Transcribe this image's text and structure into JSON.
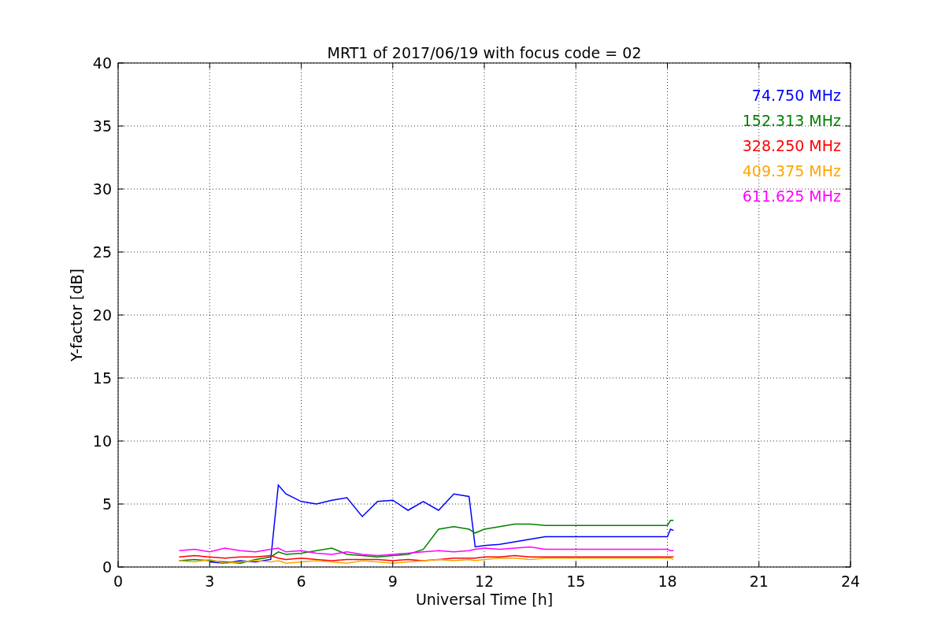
{
  "figure": {
    "chart_data": {
      "type": "line",
      "title": "MRT1 of 2017/06/19 with focus code = 02",
      "xlabel": "Universal Time [h]",
      "ylabel": "Y-factor [dB]",
      "x": [
        2,
        2.5,
        3,
        3.5,
        4,
        4.5,
        5,
        5.25,
        5.5,
        6,
        6.5,
        7,
        7.5,
        8,
        8.5,
        9,
        9.5,
        10,
        10.5,
        11,
        11.5,
        11.7,
        12,
        12.5,
        13,
        13.5,
        14,
        18,
        18.1,
        18.2
      ],
      "series": [
        {
          "name": "74.750 MHz",
          "color": "#0000ff",
          "values": [
            null,
            null,
            0.4,
            0.3,
            0.5,
            0.4,
            0.6,
            6.5,
            5.8,
            5.2,
            5.0,
            5.3,
            5.5,
            4.0,
            5.2,
            5.3,
            4.5,
            5.2,
            4.5,
            5.8,
            5.6,
            1.6,
            1.7,
            1.8,
            2.0,
            2.2,
            2.4,
            2.4,
            3.0,
            2.9
          ]
        },
        {
          "name": "152.313 MHz",
          "color": "#008000",
          "values": [
            0.5,
            0.6,
            0.5,
            0.4,
            0.3,
            0.6,
            0.8,
            1.2,
            1.0,
            1.1,
            1.3,
            1.5,
            1.0,
            0.9,
            0.8,
            0.9,
            1.0,
            1.4,
            3.0,
            3.2,
            3.0,
            2.7,
            3.0,
            3.2,
            3.4,
            3.4,
            3.3,
            3.3,
            3.7,
            3.7
          ]
        },
        {
          "name": "328.250 MHz",
          "color": "#ff0000",
          "values": [
            0.8,
            0.9,
            0.8,
            0.7,
            0.8,
            0.8,
            0.9,
            0.7,
            0.6,
            0.7,
            0.6,
            0.5,
            0.6,
            0.6,
            0.6,
            0.5,
            0.6,
            0.5,
            0.6,
            0.7,
            0.7,
            0.7,
            0.8,
            0.8,
            0.9,
            0.8,
            0.8,
            0.8,
            0.8,
            0.8
          ]
        },
        {
          "name": "409.375 MHz",
          "color": "#ffa500",
          "values": [
            0.5,
            0.4,
            0.6,
            0.3,
            0.4,
            0.5,
            0.4,
            0.5,
            0.3,
            0.4,
            0.5,
            0.4,
            0.3,
            0.5,
            0.4,
            0.3,
            0.4,
            0.5,
            0.6,
            0.5,
            0.6,
            0.5,
            0.6,
            0.7,
            0.7,
            0.6,
            0.7,
            0.7,
            0.7,
            0.6
          ]
        },
        {
          "name": "611.625 MHz",
          "color": "#ff00ff",
          "values": [
            1.3,
            1.4,
            1.2,
            1.5,
            1.3,
            1.2,
            1.4,
            1.5,
            1.2,
            1.3,
            1.1,
            1.0,
            1.2,
            1.0,
            0.9,
            1.0,
            1.1,
            1.2,
            1.3,
            1.2,
            1.3,
            1.4,
            1.5,
            1.4,
            1.5,
            1.6,
            1.4,
            1.4,
            1.3,
            1.3
          ]
        }
      ],
      "grid": true,
      "xlim": [
        0,
        24
      ],
      "ylim": [
        0,
        40
      ],
      "xticks": [
        0,
        3,
        6,
        9,
        12,
        15,
        18,
        21,
        24
      ],
      "yticks": [
        0,
        5,
        10,
        15,
        20,
        25,
        30,
        35,
        40
      ]
    }
  }
}
